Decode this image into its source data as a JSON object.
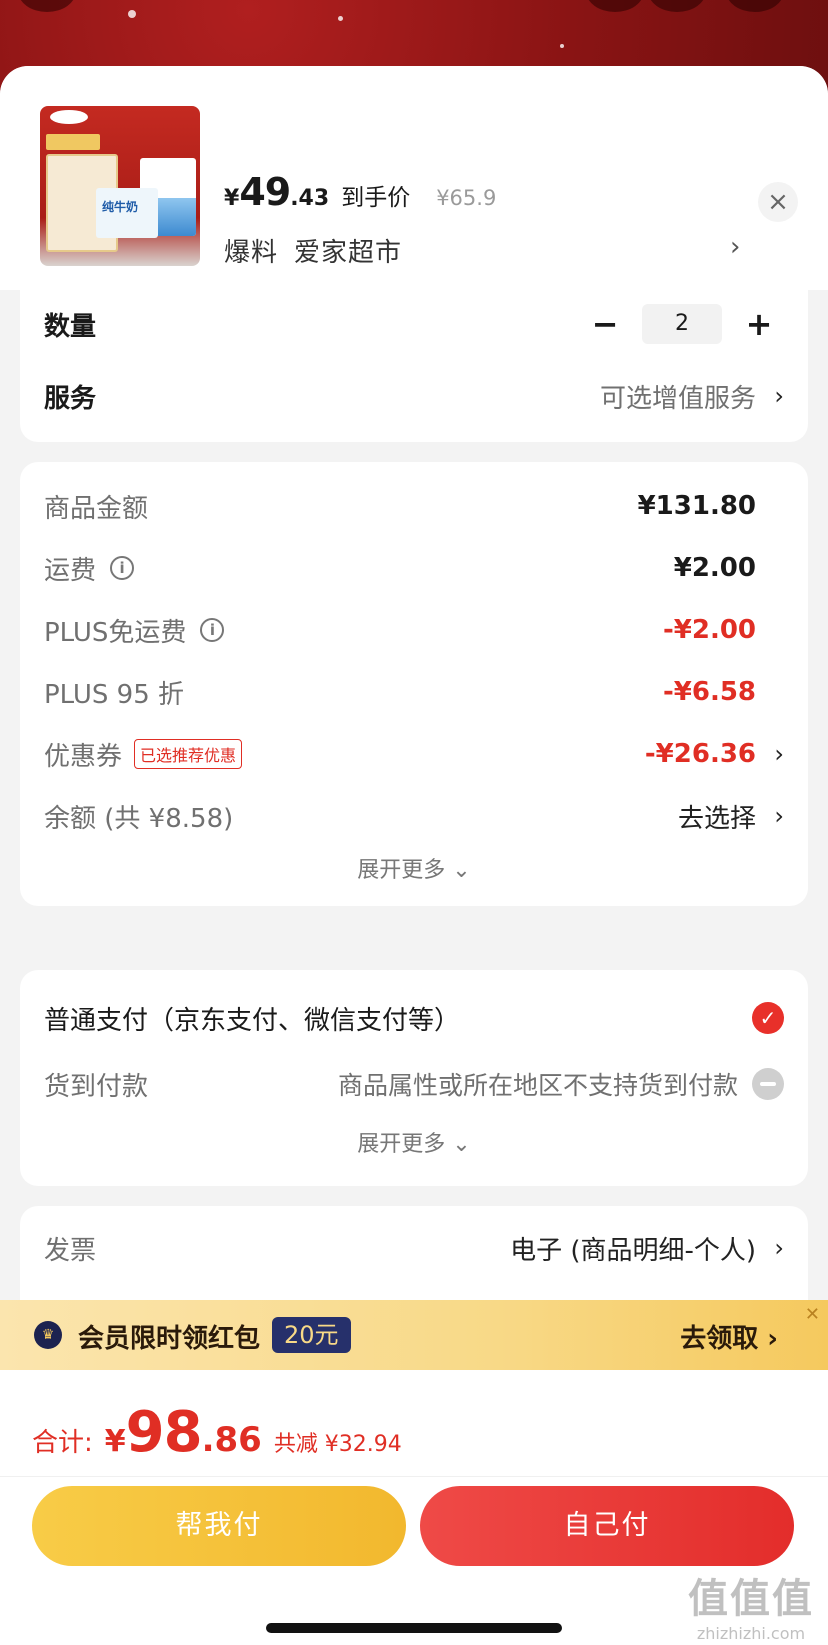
{
  "product": {
    "price_yen_symbol": "¥",
    "price_integer": "49",
    "price_decimal": ".43",
    "price_label": "到手价",
    "original_price": "¥65.9",
    "tag": "爆料",
    "shop_name": "爱家超市",
    "thumbnail_text": "纯牛奶",
    "close_glyph": "×",
    "chevron": "›"
  },
  "quantity": {
    "label": "数量",
    "minus": "−",
    "value": "2",
    "plus": "+"
  },
  "service": {
    "label": "服务",
    "value": "可选增值服务",
    "chevron": "›"
  },
  "charges": {
    "rows": [
      {
        "label": "商品金额",
        "value": "¥131.80"
      },
      {
        "label": "运费",
        "info": "i",
        "value": "¥2.00"
      },
      {
        "label": "PLUS免运费",
        "info": "i",
        "value": "-¥2.00"
      },
      {
        "label": "PLUS 95 折",
        "value": "-¥6.58"
      },
      {
        "label": "优惠券",
        "badge": "已选推荐优惠",
        "value": "-¥26.36",
        "chevron": "›"
      },
      {
        "label": "余额 (共 ¥8.58)",
        "value": "去选择",
        "chevron": "›"
      }
    ],
    "expand_label": "展开更多 ⌄"
  },
  "payment": {
    "options": [
      {
        "label": "普通支付（京东支付、微信支付等）",
        "check": "✓"
      },
      {
        "label": "货到付款",
        "note": "商品属性或所在地区不支持货到付款"
      }
    ],
    "expand_label": "展开更多 ⌄"
  },
  "invoice": {
    "label": "发票",
    "value": "电子 (商品明细-个人)",
    "chevron": "›"
  },
  "promo": {
    "crown_icon": "♛",
    "text": "会员限时领红包",
    "amount": "20元",
    "action": "去领取 ›",
    "close": "✕"
  },
  "footer": {
    "total_label": "合计:",
    "total_yen": "¥",
    "total_integer": "98",
    "total_decimal": ".86",
    "savings": "共减 ¥32.94",
    "help_pay_label": "帮我付",
    "self_pay_label": "自己付",
    "watermark_text": "值值值",
    "watermark_url": "zhizhizhi.com"
  },
  "colors": {
    "accent_red": "#e02e24",
    "pay_yellow": "#f8cc47",
    "pay_red": "#ef4a47",
    "promo_gold": "#f8d987",
    "promo_navy": "#26306b"
  }
}
